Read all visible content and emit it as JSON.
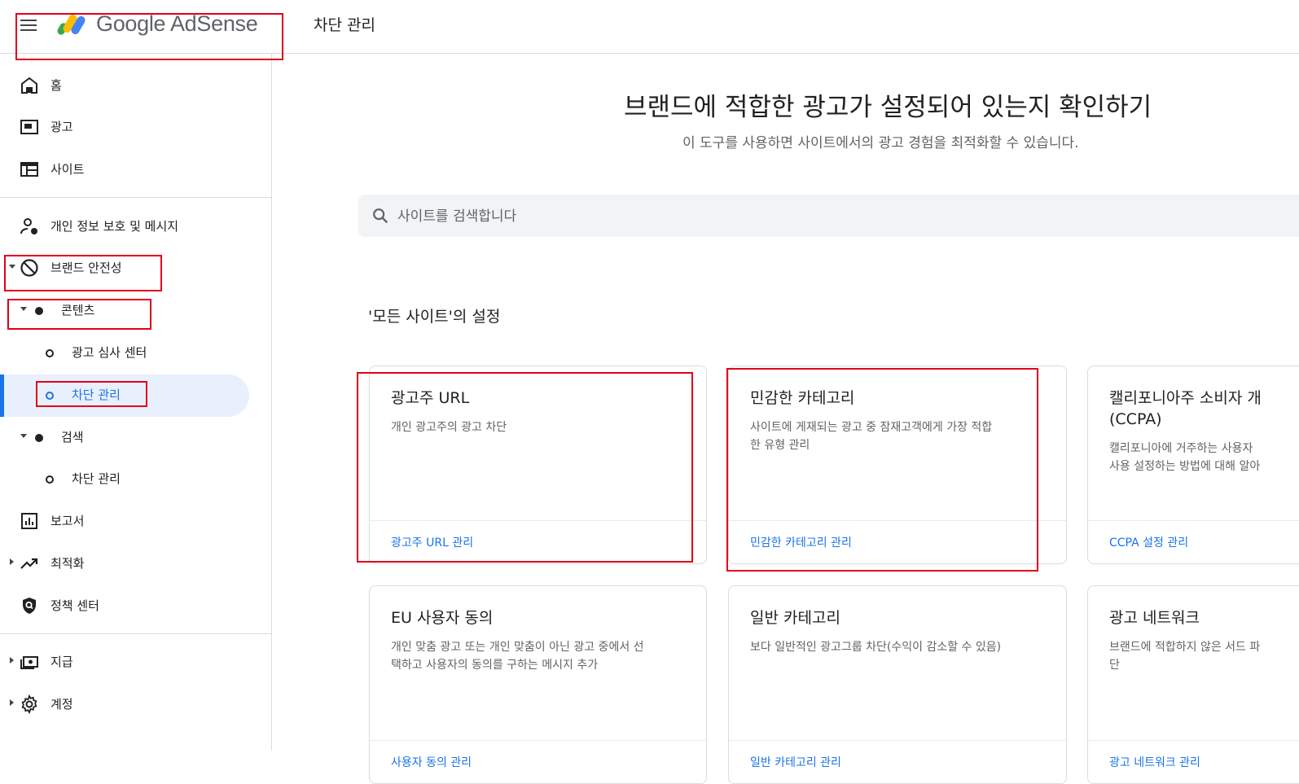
{
  "app": {
    "logo_text": "Google AdSense",
    "page_title": "차단 관리"
  },
  "sidebar": {
    "items": [
      {
        "key": "home",
        "label": "홈"
      },
      {
        "key": "ads",
        "label": "광고"
      },
      {
        "key": "sites",
        "label": "사이트"
      },
      {
        "key": "privacy",
        "label": "개인 정보 보호 및 메시지"
      },
      {
        "key": "brand-safety",
        "label": "브랜드 안전성"
      },
      {
        "key": "content",
        "label": "콘텐츠"
      },
      {
        "key": "ad-review",
        "label": "광고 심사 센터"
      },
      {
        "key": "blocking-controls",
        "label": "차단 관리"
      },
      {
        "key": "search",
        "label": "검색"
      },
      {
        "key": "search-blocking",
        "label": "차단 관리"
      },
      {
        "key": "reports",
        "label": "보고서"
      },
      {
        "key": "optimization",
        "label": "최적화"
      },
      {
        "key": "policy-center",
        "label": "정책 센터"
      },
      {
        "key": "payments",
        "label": "지급"
      },
      {
        "key": "account",
        "label": "계정"
      }
    ]
  },
  "main": {
    "title": "브랜드에 적합한 광고가 설정되어 있는지 확인하기",
    "subtitle": "이 도구를 사용하면 사이트에서의 광고 경험을 최적화할 수 있습니다.",
    "search_placeholder": "사이트를 검색합니다",
    "section_title": "'모든 사이트'의 설정",
    "cards": [
      {
        "title": "광고주 URL",
        "desc": "개인 광고주의 광고 차단",
        "link": "광고주 URL 관리"
      },
      {
        "title": "민감한 카테고리",
        "desc": "사이트에 게재되는 광고 중 잠재고객에게 가장 적합\n한 유형 관리",
        "link": "민감한 카테고리 관리"
      },
      {
        "title": "캘리포니아주 소비자 개\n(CCPA)",
        "desc": "캘리포니아에 거주하는 사용자\n사용 설정하는 방법에 대해 알아",
        "link": "CCPA 설정 관리"
      },
      {
        "title": "EU 사용자 동의",
        "desc": "개인 맞춤 광고 또는 개인 맞춤이 아닌 광고 중에서 선\n택하고 사용자의 동의를 구하는 메시지 추가",
        "link": "사용자 동의 관리"
      },
      {
        "title": "일반 카테고리",
        "desc": "보다 일반적인 광고그룹 차단(수익이 감소할 수 있음)",
        "link": "일반 카테고리 관리"
      },
      {
        "title": "광고 네트워크",
        "desc": "브랜드에 적합하지 않은 서드 파\n단",
        "link": "광고 네트워크 관리"
      }
    ]
  },
  "colors": {
    "accent": "#1a73e8",
    "annotation": "#e0001b",
    "active_bg": "#e8f0fe"
  },
  "icons": [
    "menu-icon",
    "adsense-logo-icon",
    "home-icon",
    "ads-icon",
    "sites-icon",
    "privacy-icon",
    "block-icon",
    "reports-icon",
    "trending-icon",
    "policy-shield-icon",
    "payments-icon",
    "gear-icon",
    "search-icon"
  ]
}
